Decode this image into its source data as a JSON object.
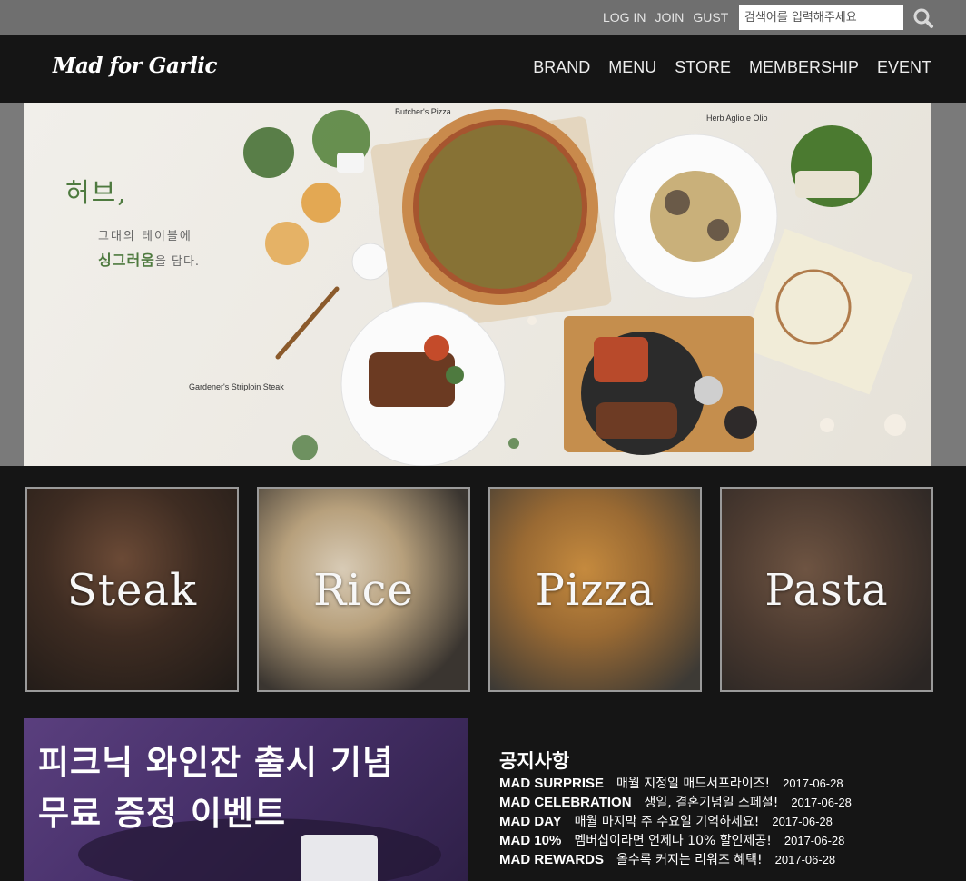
{
  "topbar": {
    "links": [
      "LOG IN",
      "JOIN",
      "GUST"
    ],
    "search_placeholder": "검색어를 입력해주세요",
    "search_icon": "search-icon"
  },
  "header": {
    "logo": "Mad for Garlic",
    "nav": [
      "BRAND",
      "MENU",
      "STORE",
      "MEMBERSHIP",
      "EVENT"
    ]
  },
  "hero": {
    "title": "허브,",
    "sub1": "그대의 테이블에",
    "sub2_bold": "싱그러움",
    "sub2_rest": "을 담다.",
    "labels": {
      "pizza": "Butcher's Pizza",
      "pasta": "Herb Aglio e Olio",
      "steak": "Gardener's Striploin Steak"
    }
  },
  "tiles": [
    "Steak",
    "Rice",
    "Pizza",
    "Pasta"
  ],
  "promo": {
    "line1": "피크닉 와인잔 출시 기념",
    "line2": "무료 증정 이벤트"
  },
  "notice": {
    "title": "공지사항",
    "items": [
      {
        "head": "MAD SURPRISE",
        "desc": "매월 지정일 매드서프라이즈!",
        "date": "2017-06-28"
      },
      {
        "head": "MAD CELEBRATION",
        "desc": "생일, 결혼기념일 스페셜!",
        "date": "2017-06-28"
      },
      {
        "head": "MAD DAY",
        "desc": "매월 마지막 주 수요일 기억하세요!",
        "date": "2017-06-28"
      },
      {
        "head": "MAD 10%",
        "desc": "멤버십이라면 언제나 10% 할인제공!",
        "date": "2017-06-28"
      },
      {
        "head": "MAD REWARDS",
        "desc": "올수록 커지는 리워즈 혜택!",
        "date": "2017-06-28"
      }
    ]
  },
  "colors": {
    "topbar": "#6f6f6f",
    "header": "#151515",
    "herb_green": "#4e7a3f",
    "promo_purple": "#4a3270"
  }
}
